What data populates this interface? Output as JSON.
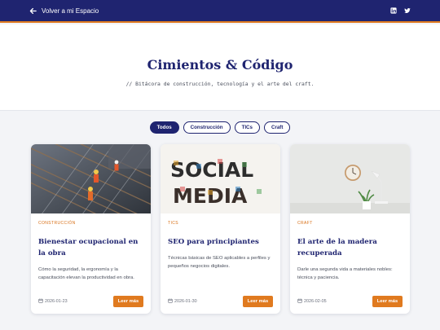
{
  "topbar": {
    "back_label": "Volver a mi Espacio",
    "social": [
      {
        "icon": "linkedin-icon"
      },
      {
        "icon": "twitter-icon"
      }
    ],
    "colors": {
      "background": "#1f2470",
      "accent": "#e07a1f"
    }
  },
  "hero": {
    "title": "Cimientos & Código",
    "subtitle": "// Bitácora de construcción, tecnología y el arte del craft."
  },
  "filters": [
    {
      "label": "Todos",
      "active": true
    },
    {
      "label": "Construcción",
      "active": false
    },
    {
      "label": "TICs",
      "active": false
    },
    {
      "label": "Craft",
      "active": false
    }
  ],
  "posts": [
    {
      "category": "CONSTRUCCIÓN",
      "title": "Bienestar ocupacional en la obra",
      "description": "Cómo la seguridad, la ergonomía y la capacitación elevan la productividad en obra.",
      "date": "2026-01-23",
      "button": "Leer más",
      "image": "construction-site-photo"
    },
    {
      "category": "TICS",
      "title": "SEO para principiantes",
      "description": "Técnicas básicas de SEO aplicables a perfiles y pequeños negocios digitales.",
      "date": "2026-01-30",
      "button": "Leer más",
      "image": "social-media-letters-photo",
      "image_text": [
        "SOCIAL",
        "MEDIA"
      ]
    },
    {
      "category": "CRAFT",
      "title": "El arte de la madera recuperada",
      "description": "Darle una segunda vida a materiales nobles: técnica y paciencia.",
      "date": "2026-02-05",
      "button": "Leer más",
      "image": "wall-clock-lamp-photo"
    }
  ]
}
